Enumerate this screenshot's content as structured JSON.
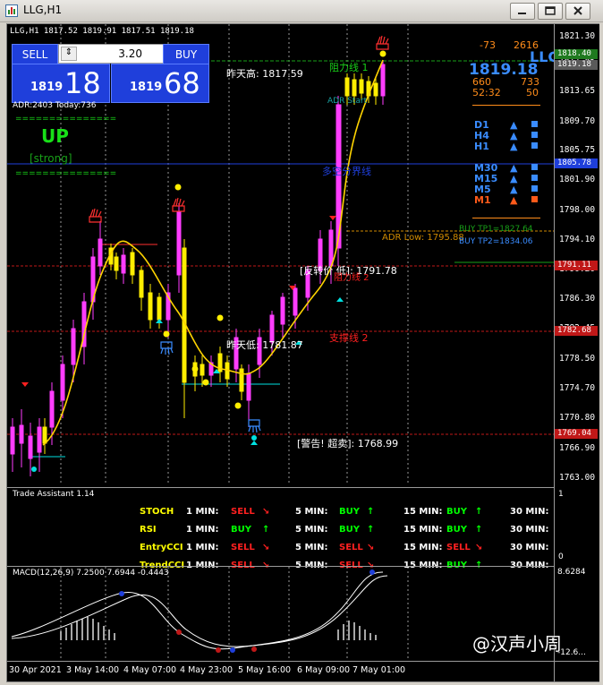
{
  "window": {
    "title": "LLG,H1"
  },
  "chart_info": {
    "symbol_line": "LLG,H1  1817.52 1819.91 1817.51 1819.18"
  },
  "trade_panel": {
    "sell_label": "SELL",
    "buy_label": "BUY",
    "lot_value": "3.20",
    "bid_prefix": "1819",
    "bid_big": "18",
    "ask_prefix": "1819",
    "ask_big": "68"
  },
  "adr_info": "ADR:2403   Today:736",
  "trend": {
    "direction": "UP",
    "strength": "[strong]",
    "divider": "==============="
  },
  "dashboard": {
    "top_left": "-73",
    "top_right": "2616",
    "symbol": "LLG",
    "price": "1819.18",
    "row2_left": "660",
    "row2_right": "733",
    "row3_left": "52:32",
    "row3_right": "50",
    "timeframes": [
      {
        "name": "D1",
        "color": "#3a8cff"
      },
      {
        "name": "H4",
        "color": "#3a8cff"
      },
      {
        "name": "H1",
        "color": "#3a8cff"
      },
      {
        "name": "M30",
        "color": "#3a8cff"
      },
      {
        "name": "M15",
        "color": "#3a8cff"
      },
      {
        "name": "M5",
        "color": "#3a8cff"
      },
      {
        "name": "M1",
        "color": "#ff5a1a"
      }
    ]
  },
  "annotations": {
    "yesterday_high": "昨天高: 1817.59",
    "resistance1": "阻力线 1",
    "adr_start": "ADR Start",
    "bull_line": "多空分界线",
    "adr_low": "ADR Low: 1795.88",
    "buy_tp1": "BUY TP1=1827.64",
    "buy_tp2": "BUY TP2=1834.06",
    "reversal_low": "[反转价 低]: 1791.78",
    "resistance2": "阻力线 2",
    "yesterday_low": "昨天低: 1781.87",
    "support2": "支撑线 2",
    "warning_oversold": "[警告! 超卖]: 1768.99"
  },
  "price_axis": {
    "ticks": [
      "1821.30",
      "1817.85",
      "1813.65",
      "1809.70",
      "1805.75",
      "1801.90",
      "1798.00",
      "1794.10",
      "1790.20",
      "1786.30",
      "1782.45",
      "1778.50",
      "1774.70",
      "1770.80",
      "1766.90",
      "1763.00"
    ],
    "tags": [
      {
        "value": "1818.40",
        "color": "#1f7a1f"
      },
      {
        "value": "1819.18",
        "color": "#5a5a5a"
      },
      {
        "value": "1805.78",
        "color": "#1f3fdb"
      },
      {
        "value": "1791.11",
        "color": "#c01818"
      },
      {
        "value": "1782.68",
        "color": "#c01818"
      },
      {
        "value": "1769.04",
        "color": "#c01818"
      }
    ]
  },
  "trade_assistant": {
    "title": "Trade Assistant 1.14",
    "rows": [
      {
        "name": "STOCH",
        "m1": "SELL",
        "m5": "BUY",
        "m15": "BUY"
      },
      {
        "name": "RSI",
        "m1": "BUY",
        "m5": "BUY",
        "m15": "BUY"
      },
      {
        "name": "EntryCCI",
        "m1": "SELL",
        "m5": "SELL",
        "m15": "SELL"
      },
      {
        "name": "TrendCCI",
        "m1": "SELL",
        "m5": "SELL",
        "m15": "BUY"
      }
    ],
    "tf_labels": [
      "1 MIN:",
      "5 MIN:",
      "15 MIN:",
      "30 MIN:"
    ],
    "axis_top": "1",
    "axis_bottom": "0"
  },
  "macd": {
    "label": "MACD(12,26,9) 7.2500 7.6944 -0.4443",
    "axis_top": "8.6284",
    "axis_bottom": "-12.6..."
  },
  "time_axis": [
    "30 Apr 2021",
    "3 May 14:00",
    "4 May 07:00",
    "4 May 23:00",
    "5 May 16:00",
    "6 May 09:00",
    "7 May 01:00"
  ],
  "watermark": "@汉声小周"
}
